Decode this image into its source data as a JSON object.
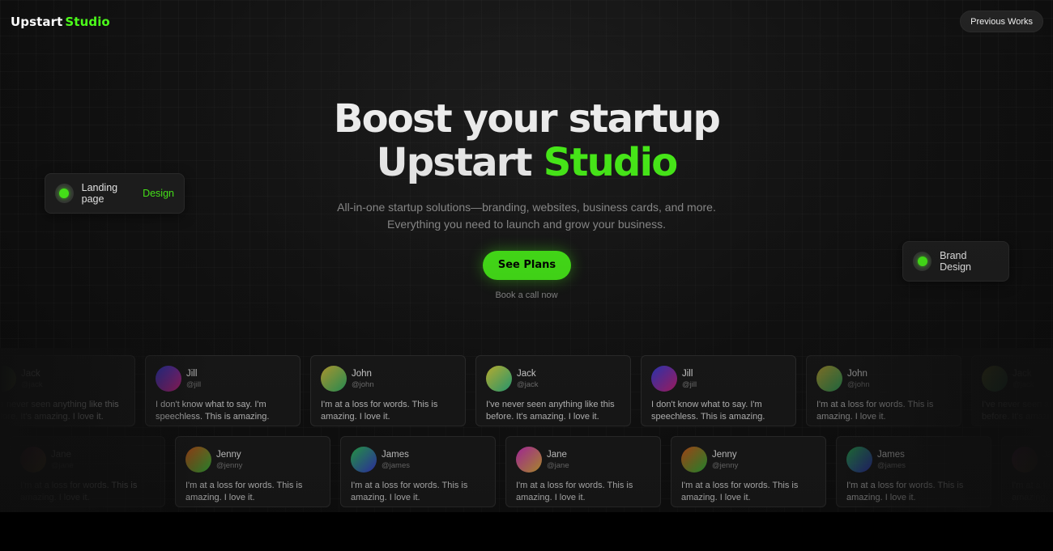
{
  "nav": {
    "brand_first": "Upstart",
    "brand_second": "Studio",
    "previous_works_label": "Previous Works"
  },
  "hero": {
    "line1": "Boost your startup",
    "line2_first": "Upstart",
    "line2_accent": "Studio",
    "sub_line1": "All-in-one startup solutions—branding, websites, business cards, and more.",
    "sub_line2": "Everything you need to launch and grow your business.",
    "cta_label": "See Plans",
    "cta_sub": "Book a call now"
  },
  "pills": {
    "left_text": "Landing page",
    "left_accent": "Design",
    "right_text": "Brand Design"
  },
  "colors": {
    "accent": "#4dff1a",
    "background": "#121212",
    "card": "#1b1b1b"
  },
  "testimonials_row1": [
    {
      "name": "Jack",
      "handle": "@jack",
      "text": "I've never seen anything like this before. It's amazing. I love it."
    },
    {
      "name": "Jill",
      "handle": "@jill",
      "text": "I don't know what to say. I'm speechless. This is amazing."
    },
    {
      "name": "John",
      "handle": "@john",
      "text": "I'm at a loss for words. This is amazing. I love it."
    },
    {
      "name": "Jack",
      "handle": "@jack",
      "text": "I've never seen anything like this before. It's amazing. I love it."
    },
    {
      "name": "Jill",
      "handle": "@jill",
      "text": "I don't know what to say. I'm speechless. This is amazing."
    },
    {
      "name": "John",
      "handle": "@john",
      "text": "I'm at a loss for words. This is amazing. I love it."
    },
    {
      "name": "Jack",
      "handle": "@jack",
      "text": "I've never seen anything like this before. It's amazing. I love it."
    }
  ],
  "testimonials_row2": [
    {
      "name": "Jane",
      "handle": "@jane",
      "text": "I'm at a loss for words. This is amazing. I love it."
    },
    {
      "name": "Jenny",
      "handle": "@jenny",
      "text": "I'm at a loss for words. This is amazing. I love it."
    },
    {
      "name": "James",
      "handle": "@james",
      "text": "I'm at a loss for words. This is amazing. I love it."
    },
    {
      "name": "Jane",
      "handle": "@jane",
      "text": "I'm at a loss for words. This is amazing. I love it."
    },
    {
      "name": "Jenny",
      "handle": "@jenny",
      "text": "I'm at a loss for words. This is amazing. I love it."
    },
    {
      "name": "James",
      "handle": "@james",
      "text": "I'm at a loss for words. This is amazing. I love it."
    },
    {
      "name": "Jane",
      "handle": "@jane",
      "text": "I'm at a loss for words. This is amazing. I love it."
    }
  ]
}
